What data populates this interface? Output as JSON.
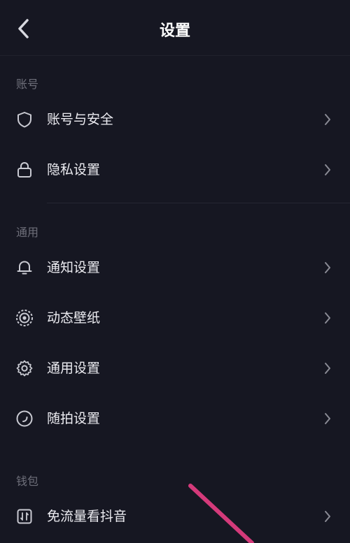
{
  "header": {
    "title": "设置",
    "back_icon": "chevron-left-icon"
  },
  "sections": [
    {
      "label": "账号",
      "items": [
        {
          "label": "账号与安全",
          "icon": "shield-icon"
        },
        {
          "label": "隐私设置",
          "icon": "lock-icon"
        }
      ]
    },
    {
      "label": "通用",
      "items": [
        {
          "label": "通知设置",
          "icon": "bell-icon"
        },
        {
          "label": "动态壁纸",
          "icon": "wallpaper-icon"
        },
        {
          "label": "通用设置",
          "icon": "gear-icon"
        },
        {
          "label": "随拍设置",
          "icon": "camera-circle-icon"
        }
      ]
    },
    {
      "label": "钱包",
      "items": [
        {
          "label": "免流量看抖音",
          "icon": "data-free-icon"
        }
      ]
    }
  ],
  "colors": {
    "background": "#161722",
    "text": "#ececf1",
    "section_label": "#6e6f7a",
    "icon": "#c9cad2",
    "chevron": "#8a8b95",
    "annotation": "#d43a7a"
  }
}
